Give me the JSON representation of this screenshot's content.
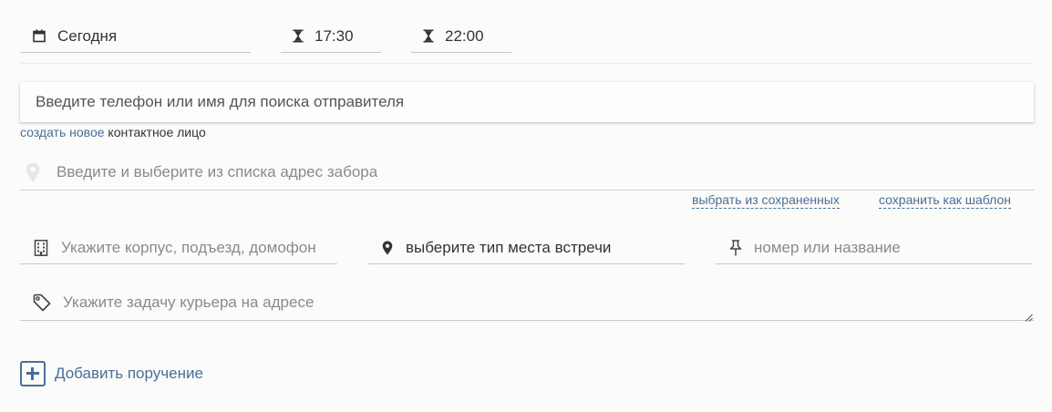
{
  "schedule": {
    "date": "Сегодня",
    "time_from": "17:30",
    "time_to": "22:00",
    "icons": {
      "date": "calendar-icon",
      "from": "hourglass-icon",
      "to": "hourglass-icon"
    }
  },
  "sender_search": {
    "placeholder": "Введите телефон или имя для поиска отправителя"
  },
  "create_contact": {
    "link": "создать новое",
    "rest": " контактное лицо"
  },
  "address": {
    "placeholder": "Введите и выберите из списка адрес забора",
    "icon": "location-pin-icon"
  },
  "address_links": {
    "choose_saved": "выбрать из сохраненных",
    "save_template": "сохранить как шаблон"
  },
  "details": {
    "building_placeholder": "Укажите корпус, подъезд, домофон",
    "meeting_place": "выберите тип места встречи",
    "number_placeholder": "номер или название"
  },
  "task": {
    "placeholder": "Укажите задачу курьера на адресе",
    "icon": "tag-icon"
  },
  "add_task": {
    "label": "Добавить поручение",
    "icon": "plus-square-icon"
  },
  "colors": {
    "accent": "#4a6e99",
    "placeholder": "#8a8a8a",
    "background": "#fbfbf9"
  }
}
